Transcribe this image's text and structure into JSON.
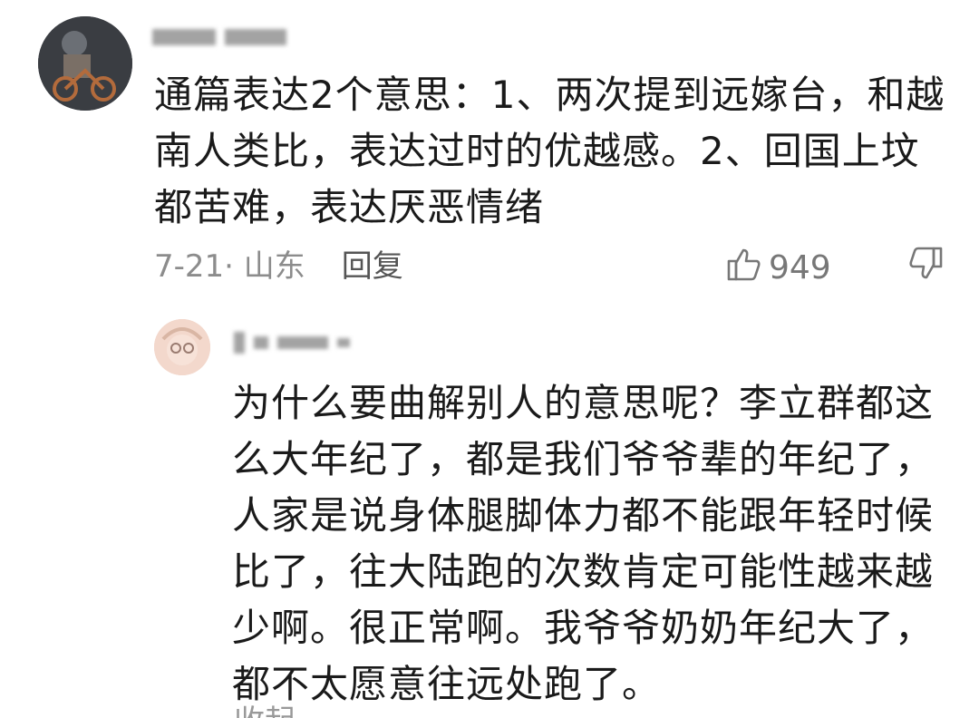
{
  "comment": {
    "text": "通篇表达2个意思：1、两次提到远嫁台，和越南人类比，表达过时的优越感。2、回国上坟都苦难，表达厌恶情绪",
    "date_location": "7-21· 山东",
    "reply_label": "回复",
    "like_count": "949"
  },
  "reply": {
    "text": "为什么要曲解别人的意思呢？李立群都这么大年纪了，都是我们爷爷辈的年纪了，人家是说身体腿脚体力都不能跟年轻时候比了，往大陆跑的次数肯定可能性越来越少啊。很正常啊。我爷爷奶奶年纪大了，都不太愿意往远处跑了。",
    "collapse_label": "收起"
  },
  "icons": {
    "like": "thumbs-up-icon",
    "dislike": "thumbs-down-icon"
  }
}
